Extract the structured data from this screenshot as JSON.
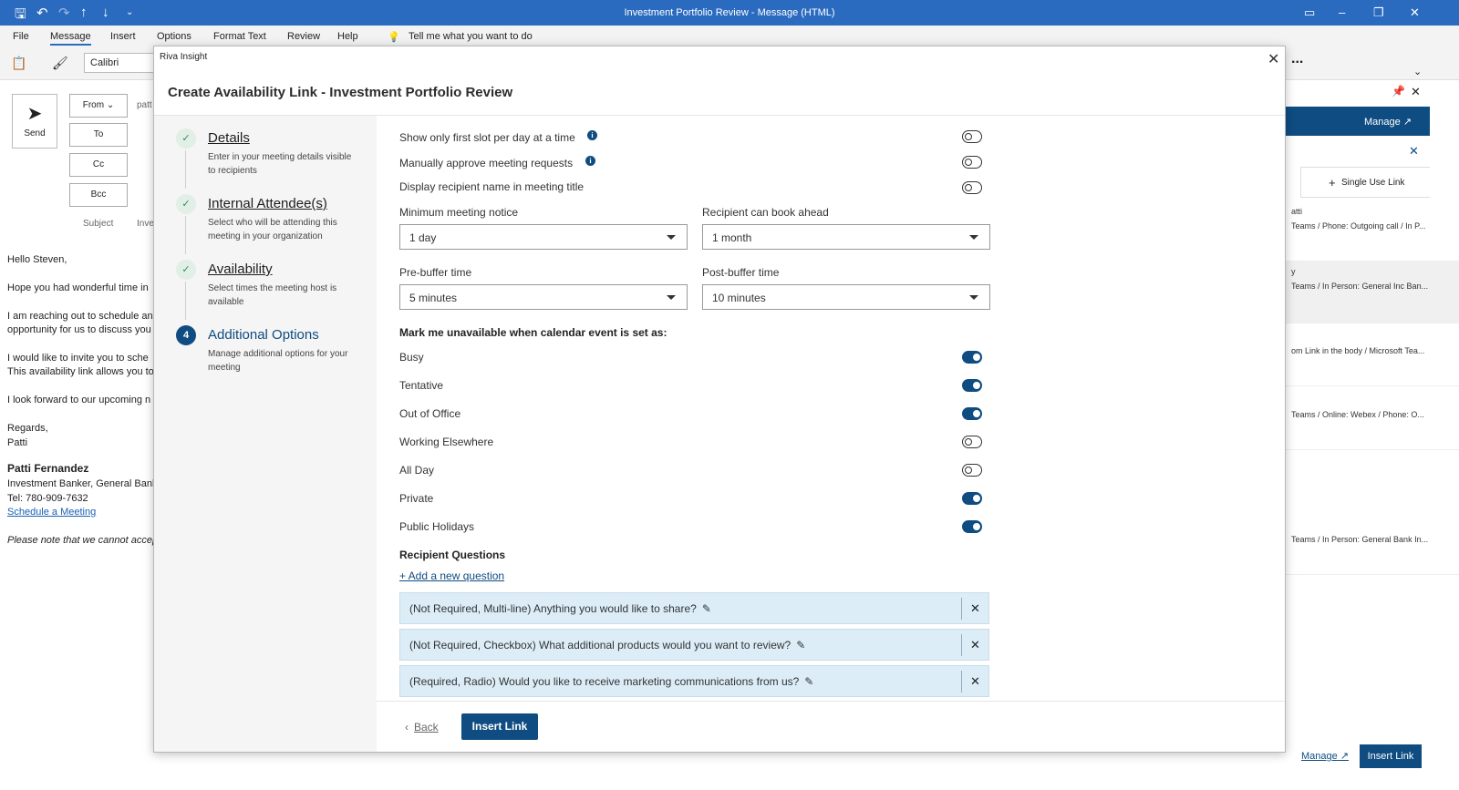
{
  "window": {
    "title": "Investment Portfolio Review - Message (HTML)"
  },
  "menu": {
    "file": "File",
    "message": "Message",
    "insert": "Insert",
    "options": "Options",
    "format_text": "Format Text",
    "review": "Review",
    "help": "Help",
    "tell_me": "Tell me what you want to do"
  },
  "ribbon": {
    "font": "Calibri",
    "more": "..."
  },
  "compose": {
    "send": "Send",
    "from": "From",
    "to": "To",
    "cc": "Cc",
    "bcc": "Bcc",
    "subject": "Subject",
    "from_value": "patt",
    "subject_value": "Inve",
    "body": {
      "greeting": "Hello Steven,",
      "line1": "Hope you had wonderful time in",
      "line2a": "I am reaching out to schedule an",
      "line2b": "opportunity for us to discuss you",
      "line3a": "I would like to invite you to sche",
      "line3b": "This availability link allows you to",
      "line4": "I look forward to our upcoming n",
      "regards": "Regards,",
      "sig_first": "Patti",
      "sig_name": "Patti Fernandez",
      "sig_title": "Investment Banker, General Bank",
      "sig_tel": "Tel: 780-909-7632",
      "sig_link": "Schedule a Meeting",
      "disclaimer": "Please note that we cannot accep"
    }
  },
  "side_panel": {
    "manage": "Manage",
    "single_use": "Single Use Link",
    "manage_footer": "Manage",
    "insert_link": "Insert Link",
    "rows": [
      {
        "name": "atti",
        "detail": "Teams / Phone: Outgoing call / In P..."
      },
      {
        "name": "y",
        "detail": "Teams / In Person: General Inc Ban..."
      },
      {
        "name": "",
        "detail": "om Link in the body / Microsoft Tea..."
      },
      {
        "name": "",
        "detail": "Teams / Online: Webex / Phone: O..."
      },
      {
        "name": "",
        "detail": "Teams / In Person: General Bank In..."
      }
    ]
  },
  "dialog": {
    "app_name": "Riva Insight",
    "title": "Create Availability Link - Investment Portfolio Review",
    "steps": [
      {
        "num": "✓",
        "title": "Details",
        "desc": "Enter in your meeting details visible to recipients"
      },
      {
        "num": "✓",
        "title": "Internal Attendee(s)",
        "desc": "Select who will be attending this meeting in your organization"
      },
      {
        "num": "✓",
        "title": "Availability",
        "desc": "Select times the meeting host is available"
      },
      {
        "num": "4",
        "title": "Additional Options",
        "desc": "Manage additional options for your meeting"
      }
    ],
    "options": {
      "first_slot": {
        "label": "Show only first slot per day at a time",
        "on": false
      },
      "manual_approve": {
        "label": "Manually approve meeting requests",
        "on": false
      },
      "display_name": {
        "label": "Display recipient name in meeting title",
        "on": false
      }
    },
    "selects": {
      "min_notice": {
        "label": "Minimum meeting notice",
        "value": "1 day"
      },
      "book_ahead": {
        "label": "Recipient can book ahead",
        "value": "1 month"
      },
      "pre_buffer": {
        "label": "Pre-buffer time",
        "value": "5 minutes"
      },
      "post_buffer": {
        "label": "Post-buffer time",
        "value": "10 minutes"
      }
    },
    "unavailable_heading": "Mark me unavailable when calendar event is set as:",
    "statuses": [
      {
        "label": "Busy",
        "on": true
      },
      {
        "label": "Tentative",
        "on": true
      },
      {
        "label": "Out of Office",
        "on": true
      },
      {
        "label": "Working Elsewhere",
        "on": false
      },
      {
        "label": "All Day",
        "on": false
      },
      {
        "label": "Private",
        "on": true
      },
      {
        "label": "Public Holidays",
        "on": true
      }
    ],
    "questions_heading": "Recipient Questions",
    "add_question": "+ Add a new question",
    "questions": [
      "(Not Required, Multi-line) Anything you would like to share?",
      "(Not Required, Checkbox) What additional products would you want to review?",
      "(Required, Radio) Would you like to receive marketing communications from us?"
    ],
    "back": "Back",
    "insert_link": "Insert Link"
  }
}
